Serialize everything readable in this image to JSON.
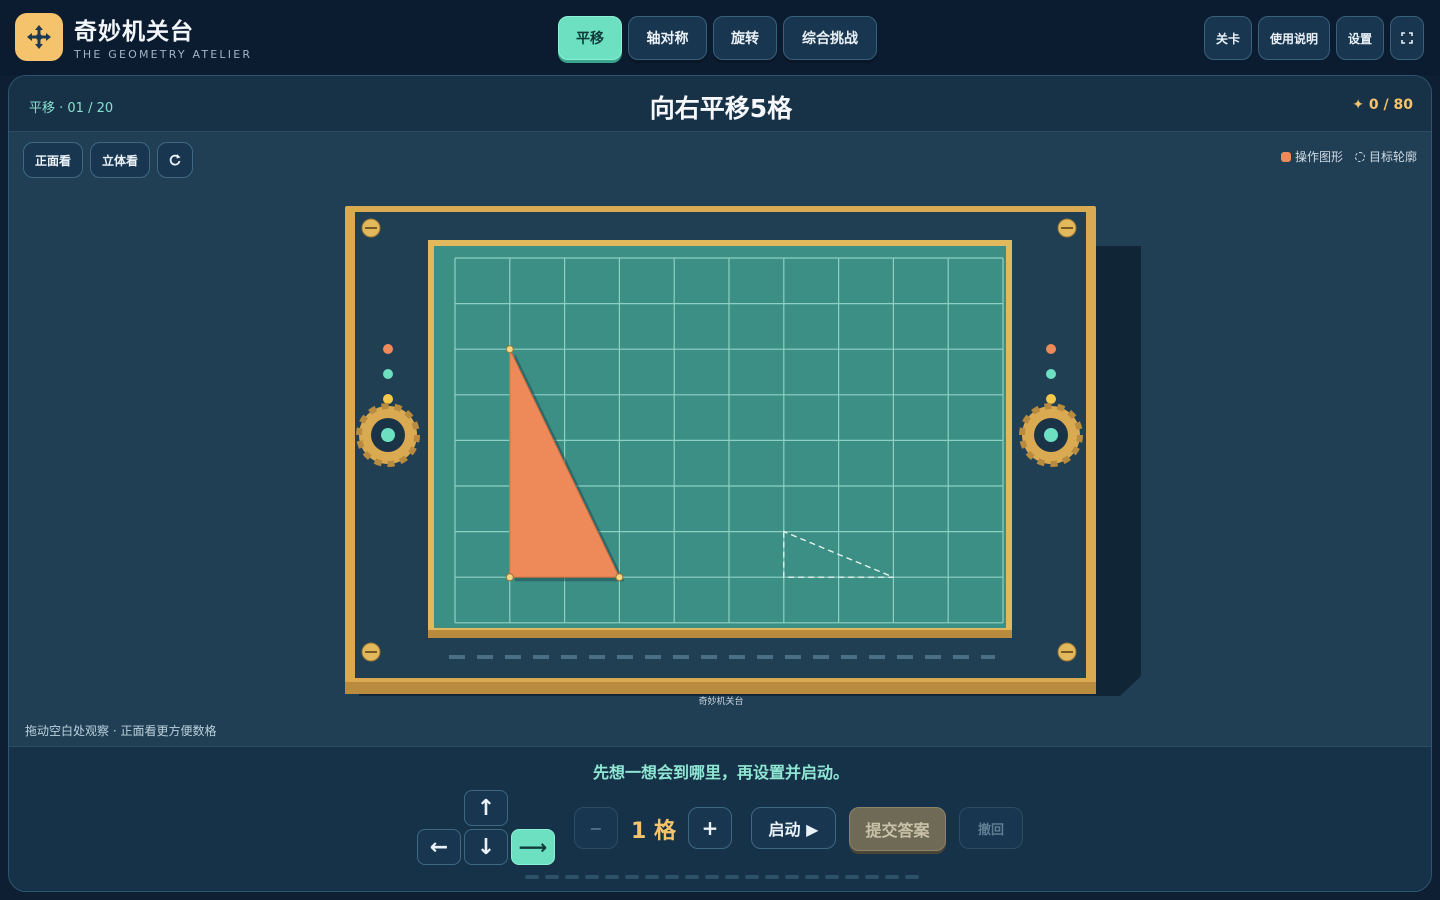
{
  "app": {
    "title": "奇妙机关台",
    "subtitle": "THE GEOMETRY ATELIER",
    "logo_icon": "move-arrows-icon",
    "accent": "#6ee0c2",
    "gold": "#f4c36b"
  },
  "tabs": [
    {
      "label": "平移",
      "active": true
    },
    {
      "label": "轴对称",
      "active": false
    },
    {
      "label": "旋转",
      "active": false
    },
    {
      "label": "综合挑战",
      "active": false
    }
  ],
  "top_actions": {
    "levels": "关卡",
    "help": "使用说明",
    "settings": "设置",
    "fullscreen_icon": "fullscreen-icon"
  },
  "header": {
    "progress": "平移 · 01 / 20",
    "task": "向右平移5格",
    "score": "✦ 0 / 80"
  },
  "view": {
    "front": "正面看",
    "three_d": "立体看",
    "reset_icon": "rotate-reset-icon"
  },
  "legend": {
    "operate": "操作图形",
    "target": "目标轮廓",
    "operate_color": "#ee8a5a"
  },
  "board": {
    "cols": 10,
    "rows": 8,
    "shape_color": "#ee8a5a",
    "shape": [
      [
        1,
        6
      ],
      [
        1,
        1
      ],
      [
        3,
        1
      ]
    ],
    "target": [
      [
        6,
        2
      ],
      [
        6,
        1
      ],
      [
        8,
        1
      ]
    ],
    "machine_label": "奇妙机关台"
  },
  "hint": "拖动空白处观察 · 正面看更方便数格",
  "controls": {
    "message": "先想一想会到哪里，再设置并启动。",
    "direction_selected": "right",
    "arrows": {
      "up": "↑",
      "left": "←",
      "down": "↓",
      "right": "⟶"
    },
    "minus": "−",
    "steps": "1 格",
    "plus": "+",
    "start": "启动 ▶",
    "submit": "提交答案",
    "undo": "撤回"
  },
  "pager_count": 20
}
